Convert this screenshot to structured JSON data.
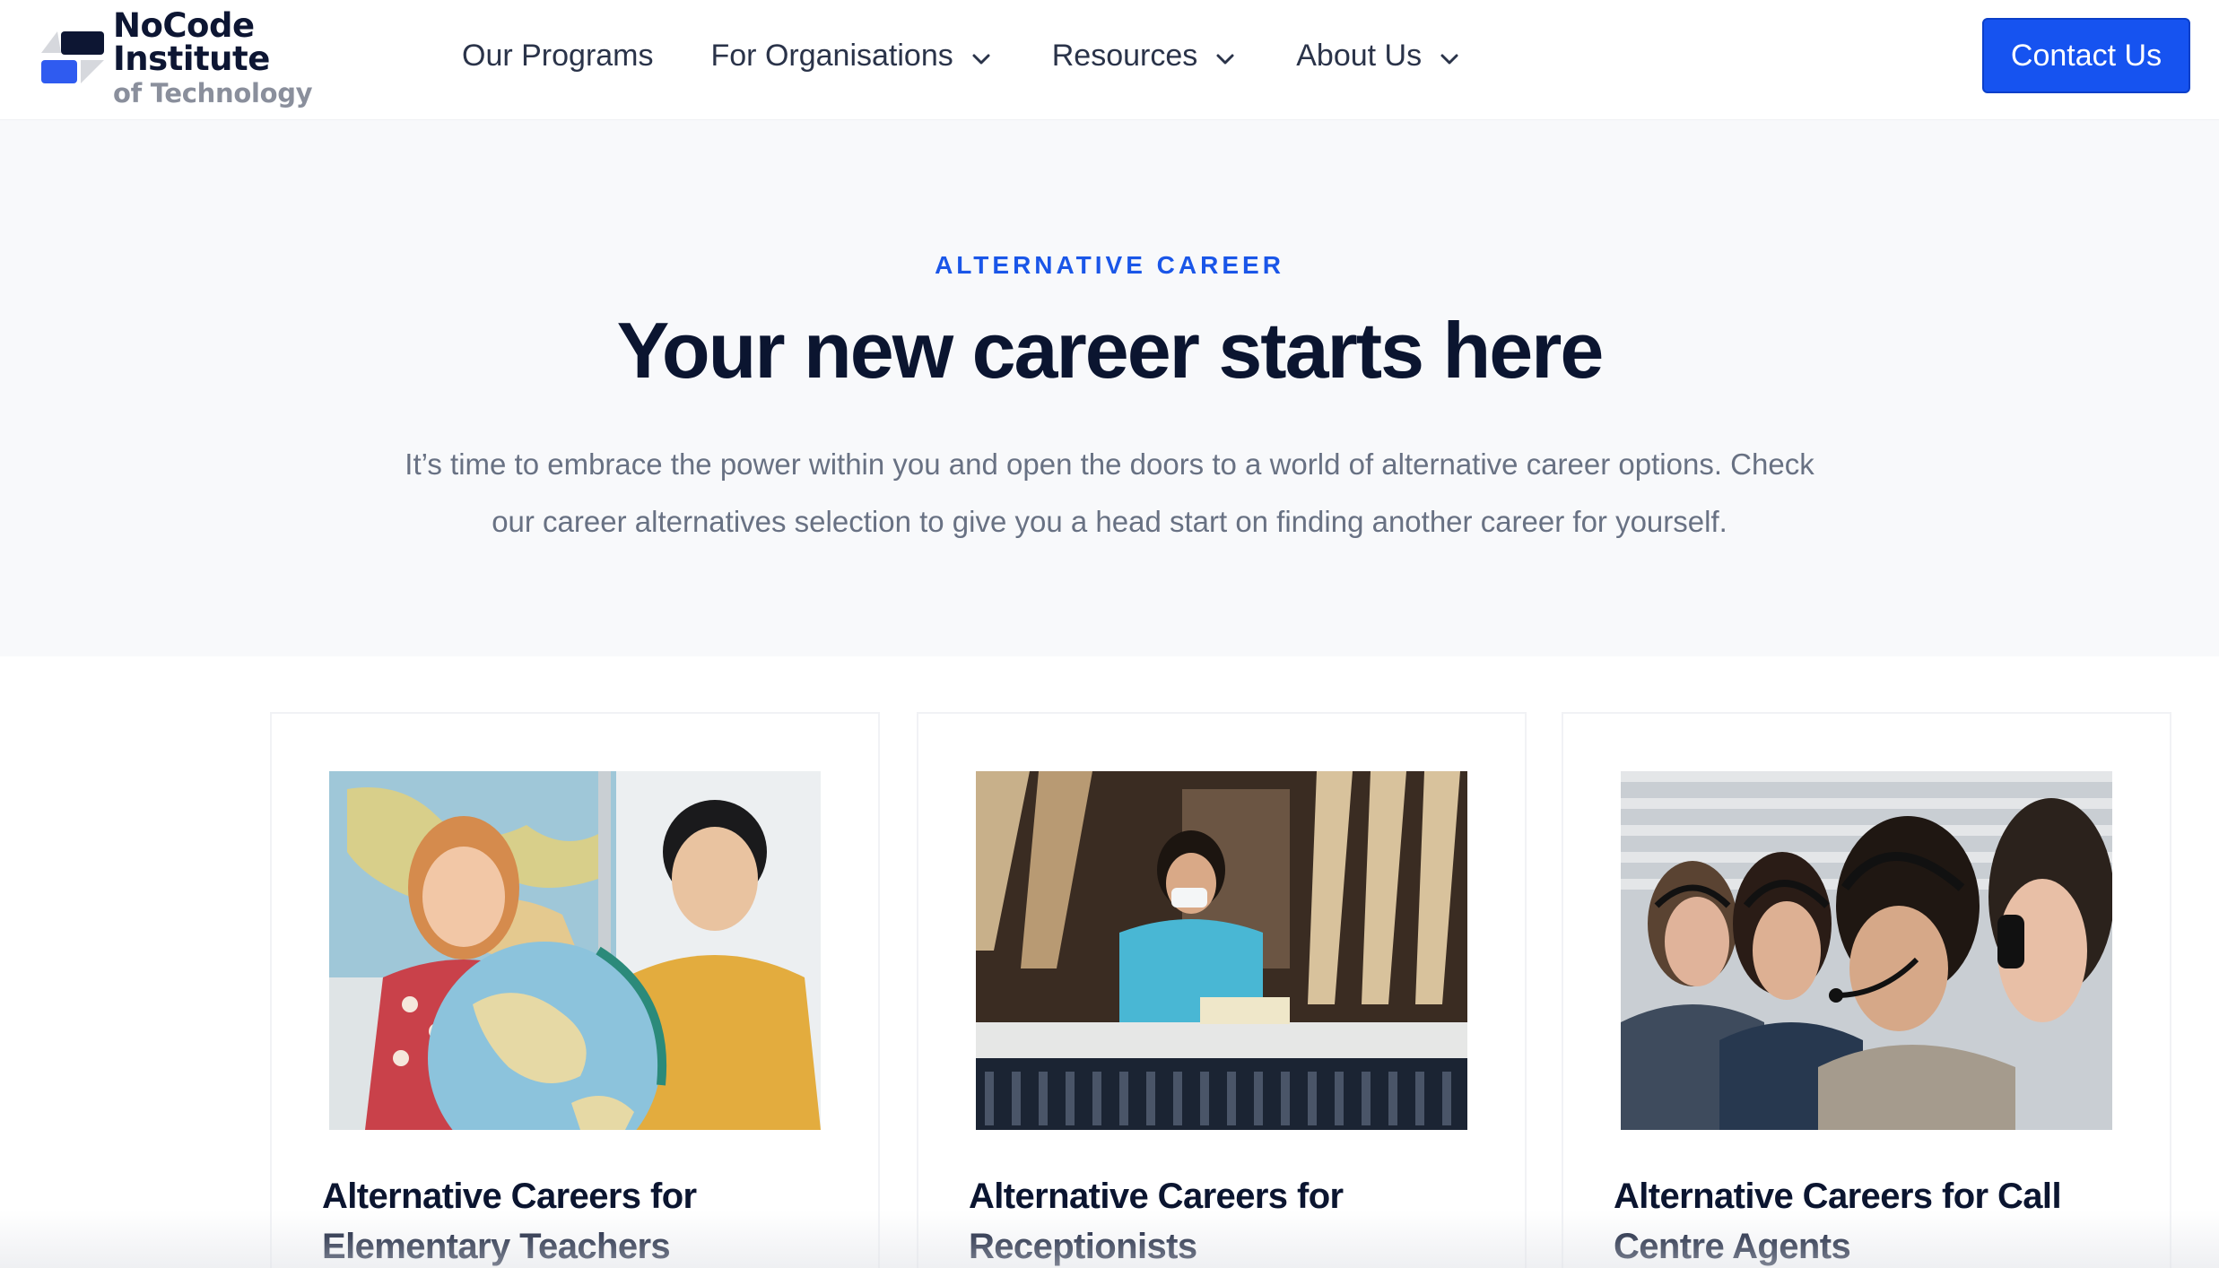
{
  "header": {
    "logo": {
      "title": "NoCode Institute",
      "subtitle": "of Technology",
      "icon": "logo-mark-icon"
    },
    "nav": [
      {
        "label": "Our Programs",
        "has_dropdown": false
      },
      {
        "label": "For Organisations",
        "has_dropdown": true
      },
      {
        "label": "Resources",
        "has_dropdown": true
      },
      {
        "label": "About Us",
        "has_dropdown": true
      }
    ],
    "contact_button": "Contact Us"
  },
  "hero": {
    "eyebrow": "ALTERNATIVE CAREER",
    "title": "Your new career starts here",
    "description_line1": "It’s time to embrace the power within you and open the doors to a world of alternative career options. Check",
    "description_line2": "our career alternatives selection to give you a head start on finding another career for yourself."
  },
  "cards": [
    {
      "title_line1": "Alternative Careers for",
      "title_line2": "Elementary Teachers",
      "image": "classroom-children-globe-photo"
    },
    {
      "title_line1": "Alternative Careers for",
      "title_line2": "Receptionists",
      "image": "receptionist-at-desk-photo"
    },
    {
      "title_line1": "Alternative Careers for Call",
      "title_line2": "Centre Agents",
      "image": "call-centre-agents-headsets-photo"
    }
  ],
  "colors": {
    "accent": "#1653f0",
    "eyebrow": "#1a56e8",
    "heading": "#0b1530",
    "body_text": "#687183",
    "hero_bg": "#f8f9fb"
  }
}
